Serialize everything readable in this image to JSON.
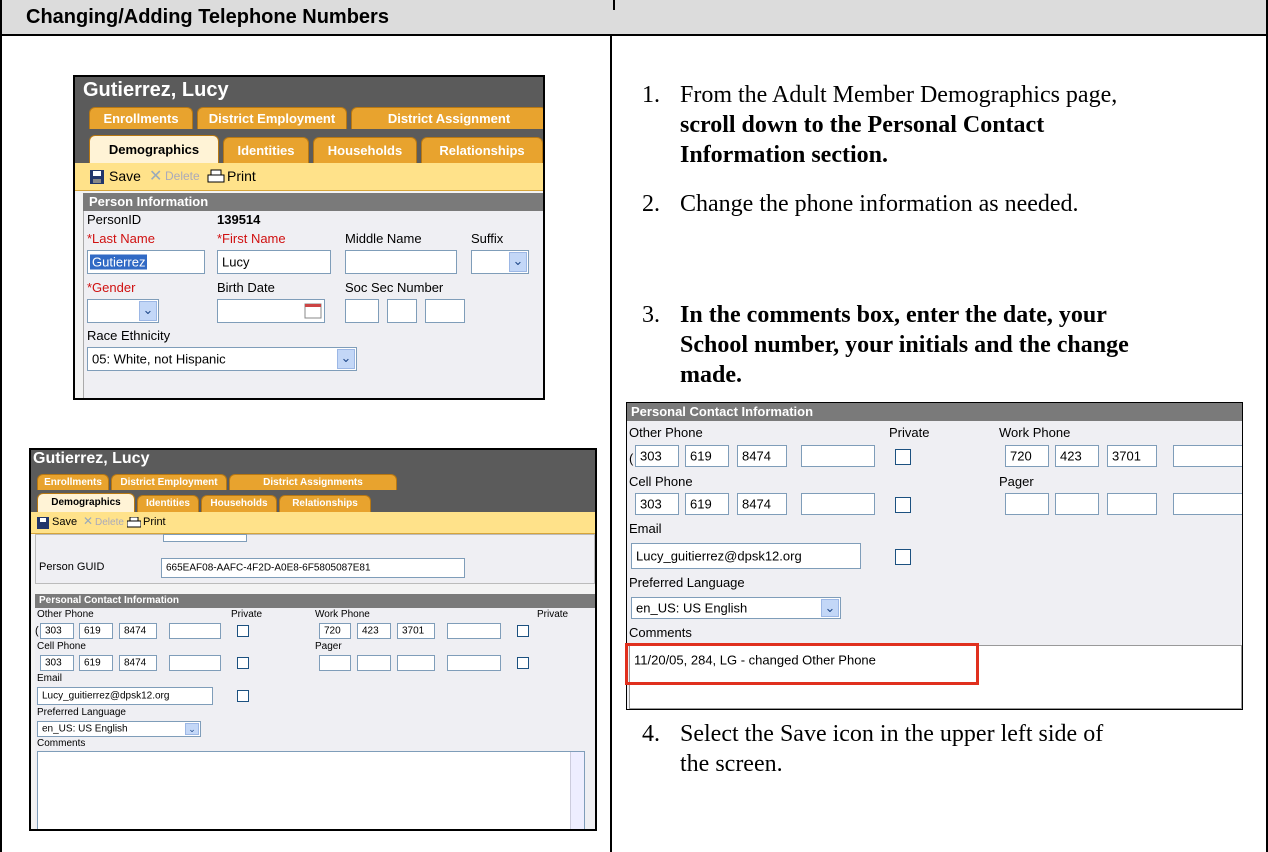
{
  "title": "Changing/Adding Telephone Numbers",
  "steps": [
    {
      "num": "1.",
      "lines": [
        "From the Adult Member Demographics page,",
        "scroll down to the Personal Contact",
        "Information section."
      ]
    },
    {
      "num": "2.",
      "lines": [
        "Change the phone information as needed."
      ]
    },
    {
      "num": "3.",
      "lines": [
        "In the comments box, enter the date, your",
        "School number, your initials and the change",
        "made."
      ]
    },
    {
      "num": "4.",
      "lines": [
        "Select the Save icon in the upper left side of",
        "the screen."
      ]
    }
  ],
  "shot1": {
    "name": "Gutierrez, Lucy",
    "tabs_row1": [
      "Enrollments",
      "District Employment",
      "District Assignment"
    ],
    "tabs_row2": [
      "Demographics",
      "Identities",
      "Households",
      "Relationships"
    ],
    "toolbar": {
      "save": "Save",
      "delete": "Delete",
      "print": "Print"
    },
    "section": "Person Information",
    "person_id_label": "PersonID",
    "person_id": "139514",
    "last_name_label": "*Last Name",
    "first_name_label": "*First Name",
    "middle_name_label": "Middle Name",
    "suffix_label": "Suffix",
    "last_name": "Gutierrez",
    "first_name": "Lucy",
    "gender_label": "*Gender",
    "birth_date_label": "Birth Date",
    "ssn_label": "Soc Sec Number",
    "race_label": "Race Ethnicity",
    "race": "05: White, not Hispanic"
  },
  "shot2": {
    "name": "Gutierrez, Lucy",
    "tabs_row1": [
      "Enrollments",
      "District Employment",
      "District Assignments"
    ],
    "tabs_row2": [
      "Demographics",
      "Identities",
      "Households",
      "Relationships"
    ],
    "toolbar": {
      "save": "Save",
      "delete": "Delete",
      "print": "Print"
    },
    "guid_label": "Person GUID",
    "guid": "665EAF08-AAFC-4F2D-A0E8-6F5805087E81",
    "section": "Personal Contact Information",
    "other_phone_label": "Other Phone",
    "private_label": "Private",
    "work_phone_label": "Work Phone",
    "private_label2": "Private",
    "other_phone": [
      "303",
      "619",
      "8474"
    ],
    "work_phone": [
      "720",
      "423",
      "3701"
    ],
    "cell_phone_label": "Cell Phone",
    "pager_label": "Pager",
    "cell_phone": [
      "303",
      "619",
      "8474"
    ],
    "email_label": "Email",
    "email": "Lucy_guitierrez@dpsk12.org",
    "language_label": "Preferred Language",
    "language": "en_US: US English",
    "comments_label": "Comments"
  },
  "shot3": {
    "section": "Personal Contact Information",
    "other_phone_label": "Other Phone",
    "private_label": "Private",
    "work_phone_label": "Work Phone",
    "other_phone": [
      "303",
      "619",
      "8474"
    ],
    "work_phone": [
      "720",
      "423",
      "3701"
    ],
    "cell_phone_label": "Cell Phone",
    "pager_label": "Pager",
    "cell_phone": [
      "303",
      "619",
      "8474"
    ],
    "email_label": "Email",
    "email": "Lucy_guitierrez@dpsk12.org",
    "language_label": "Preferred Language",
    "language": "en_US: US English",
    "comments_label": "Comments",
    "comment": "11/20/05, 284, LG - changed Other Phone"
  }
}
